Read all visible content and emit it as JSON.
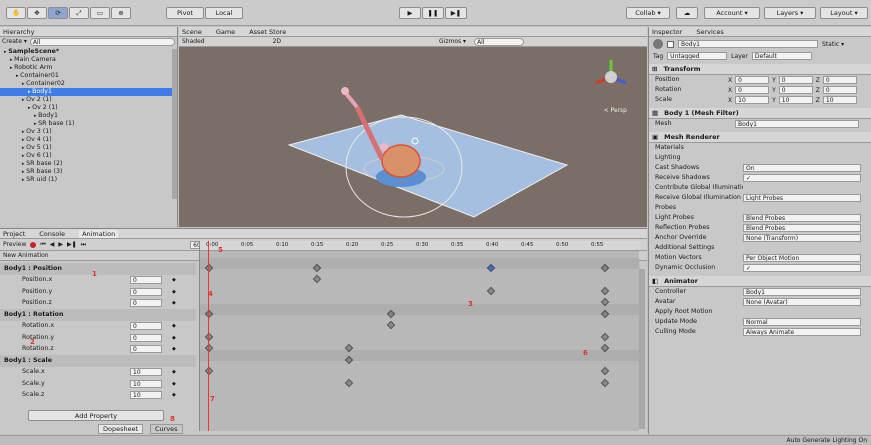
{
  "toolbar": {
    "tools": [
      "✋",
      "✥",
      "⟳",
      "⤢",
      "▭",
      "⊕"
    ],
    "pivot": "Pivot",
    "local": "Local",
    "play": "▶",
    "pause": "❚❚",
    "step": "▶❚",
    "collab": "Collab ▾",
    "cloud": "☁",
    "account": "Account ▾",
    "layers": "Layers ▾",
    "layout": "Layout ▾"
  },
  "hierarchy": {
    "tab": "Hierarchy",
    "create": "Create ▾",
    "search_placeholder": "All",
    "items": [
      {
        "label": "SampleScene*",
        "indent": 0,
        "bold": true
      },
      {
        "label": "Main Camera",
        "indent": 1
      },
      {
        "label": "Robotic Arm",
        "indent": 1
      },
      {
        "label": "Container01",
        "indent": 2
      },
      {
        "label": "Container02",
        "indent": 3
      },
      {
        "label": "Body1",
        "indent": 4,
        "selected": true
      },
      {
        "label": "Ov 2 (1)",
        "indent": 3
      },
      {
        "label": "Ov 2 (1)",
        "indent": 4
      },
      {
        "label": "Body1",
        "indent": 5
      },
      {
        "label": "SR base (1)",
        "indent": 5
      },
      {
        "label": "Ov 3 (1)",
        "indent": 3
      },
      {
        "label": "Ov 4 (1)",
        "indent": 3
      },
      {
        "label": "Ov 5 (1)",
        "indent": 3
      },
      {
        "label": "Ov 6 (1)",
        "indent": 3
      },
      {
        "label": "SR base (2)",
        "indent": 3
      },
      {
        "label": "SR base (3)",
        "indent": 3
      },
      {
        "label": "SR uid (1)",
        "indent": 3
      }
    ]
  },
  "scene": {
    "tabs": [
      "Scene",
      "Game",
      "Asset Store"
    ],
    "shading": "Shaded",
    "mode": "2D",
    "gizmos": "Gizmos ▾",
    "search_placeholder": "All",
    "persp": "< Persp"
  },
  "animation": {
    "tabs": [
      "Project",
      "Console",
      "Animation"
    ],
    "preview": "Preview",
    "clip": "New Animation",
    "samples": "60",
    "add_property": "Add Property",
    "dopesheet": "Dopesheet",
    "curves": "Curves",
    "time_labels": [
      "0:00",
      "0:05",
      "0:10",
      "0:15",
      "0:20",
      "0:25",
      "0:30",
      "0:35",
      "0:40",
      "0:45",
      "0:50",
      "0:55"
    ],
    "properties": [
      {
        "label": "Body1 : Position",
        "group": true
      },
      {
        "label": "Position.x",
        "value": "0"
      },
      {
        "label": "Position.y",
        "value": "0"
      },
      {
        "label": "Position.z",
        "value": "0"
      },
      {
        "label": "Body1 : Rotation",
        "group": true
      },
      {
        "label": "Rotation.x",
        "value": "0"
      },
      {
        "label": "Rotation.y",
        "value": "0"
      },
      {
        "label": "Rotation.z",
        "value": "0"
      },
      {
        "label": "Body1 : Scale",
        "group": true
      },
      {
        "label": "Scale.x",
        "value": "10"
      },
      {
        "label": "Scale.y",
        "value": "10"
      },
      {
        "label": "Scale.z",
        "value": "10"
      }
    ],
    "annotations": [
      "1",
      "2",
      "3",
      "4",
      "5",
      "6",
      "7",
      "8"
    ]
  },
  "inspector": {
    "tabs": [
      "Inspector",
      "Services"
    ],
    "object_name": "Body1",
    "static": "Static ▾",
    "tag_label": "Tag",
    "tag": "Untagged",
    "layer_label": "Layer",
    "layer": "Default",
    "transform": {
      "title": "Transform",
      "rows": [
        {
          "label": "Position",
          "x": "0",
          "y": "0",
          "z": "0"
        },
        {
          "label": "Rotation",
          "x": "0",
          "y": "0",
          "z": "0"
        },
        {
          "label": "Scale",
          "x": "10",
          "y": "10",
          "z": "10"
        }
      ]
    },
    "meshfilter": {
      "title": "Body 1 (Mesh Filter)",
      "mesh_label": "Mesh",
      "mesh": "Body1"
    },
    "renderer": {
      "title": "Mesh Renderer",
      "rows": [
        {
          "label": "Materials",
          "value": ""
        },
        {
          "label": "Lighting",
          "value": ""
        },
        {
          "label": "Cast Shadows",
          "value": "On"
        },
        {
          "label": "Receive Shadows",
          "value": "✓"
        },
        {
          "label": "Contribute Global Illumination",
          "value": ""
        },
        {
          "label": "Receive Global Illumination",
          "value": "Light Probes"
        },
        {
          "label": "Probes",
          "value": ""
        },
        {
          "label": "Light Probes",
          "value": "Blend Probes"
        },
        {
          "label": "Reflection Probes",
          "value": "Blend Probes"
        },
        {
          "label": "Anchor Override",
          "value": "None (Transform)"
        },
        {
          "label": "Additional Settings",
          "value": ""
        },
        {
          "label": "Motion Vectors",
          "value": "Per Object Motion"
        },
        {
          "label": "Dynamic Occlusion",
          "value": "✓"
        }
      ]
    },
    "animator": {
      "title": "Animator",
      "rows": [
        {
          "label": "Controller",
          "value": "Body1"
        },
        {
          "label": "Avatar",
          "value": "None (Avatar)"
        },
        {
          "label": "Apply Root Motion",
          "value": ""
        },
        {
          "label": "Update Mode",
          "value": "Normal"
        },
        {
          "label": "Culling Mode",
          "value": "Always Animate"
        }
      ]
    },
    "footer": "Auto Generate Lighting On"
  }
}
